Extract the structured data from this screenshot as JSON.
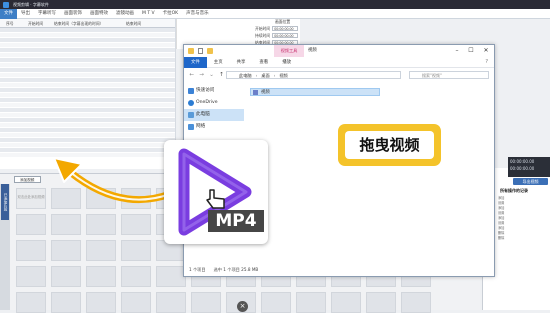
{
  "app": {
    "title": "视频剪辑 · 字幕软件",
    "menus": [
      "文件",
      "导出",
      "字幕听写",
      "画面装饰",
      "画面特效",
      "滤镜动画",
      "M T V",
      "卡拉OK",
      "声音与音乐"
    ],
    "active_menu": "文件",
    "table_headers": [
      "序号",
      "开始时间",
      "结束时间（字幕出现的时间）",
      "结束时间"
    ],
    "time_panel": {
      "label": "画面位置",
      "rows": [
        {
          "label": "开始时间",
          "value": "00:00:00.00"
        },
        {
          "label": "持续时间",
          "value": "00:00:00.00"
        },
        {
          "label": "结束时间",
          "value": "00:00:00.00"
        }
      ]
    },
    "add_media": "添加视频",
    "media_sidebar_tab": "已添加片段",
    "first_tile_text": "双击此处添加视频",
    "time_display": [
      "00:00:00.00",
      "00:00:00.00"
    ],
    "export_button": "导出视频",
    "log_title": "所有操作的记录",
    "log_lines": [
      "添加",
      "设置",
      "添加",
      "设置",
      "添加",
      "设置",
      "添加",
      "删除",
      "删除"
    ]
  },
  "explorer": {
    "video_tools": "视频工具",
    "title": "视频",
    "ribbon_tabs": [
      "文件",
      "主页",
      "共享",
      "查看",
      "播放"
    ],
    "path": [
      "此电脑",
      "桌面",
      "视频"
    ],
    "search_placeholder": "搜索\"视频\"",
    "nav_items": [
      {
        "label": "快速访问",
        "icon": "star-icon",
        "color": "#3b82d6"
      },
      {
        "label": "OneDrive",
        "icon": "cloud-icon",
        "color": "#2b7cd3"
      },
      {
        "label": "此电脑",
        "icon": "computer-icon",
        "color": "#5a9bd8"
      },
      {
        "label": "网络",
        "icon": "network-icon",
        "color": "#4a90d9"
      }
    ],
    "selected_nav": "此电脑",
    "file_name": "视频",
    "status_left": "1 个项目",
    "status_sel": "选中 1 个项目  25.8 MB"
  },
  "callout_text": "拖曳视频",
  "mp4_label": "MP4",
  "colors": {
    "accent": "#3e7fc6",
    "callout": "#f4c32a",
    "mp4_purple": "#7a3de0",
    "arrow": "#f3a800"
  }
}
